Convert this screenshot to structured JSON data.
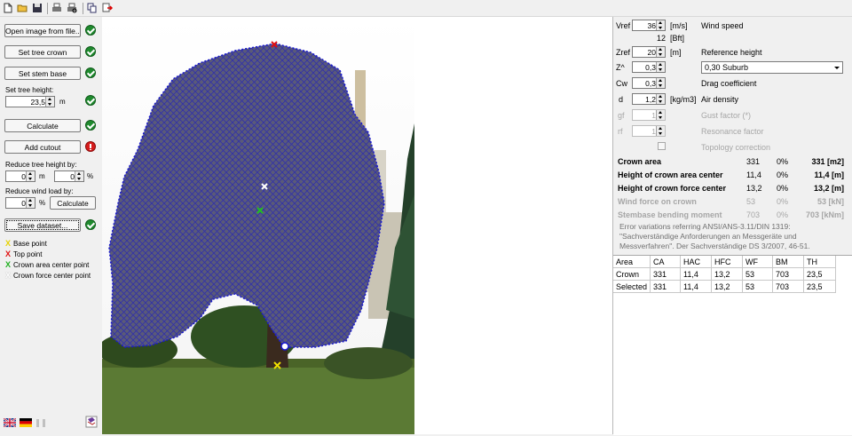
{
  "left": {
    "open_image": "Open image from file...",
    "set_crown": "Set tree crown",
    "set_stem": "Set stem base",
    "set_height_label": "Set tree height:",
    "tree_height": "23,5",
    "height_unit": "m",
    "calculate": "Calculate",
    "add_cutout": "Add cutout",
    "reduce_height_label": "Reduce tree height by:",
    "reduce_height_m": "0",
    "reduce_height_pct": "0",
    "unit_m": "m",
    "unit_pct": "%",
    "reduce_wind_label": "Reduce wind load by:",
    "reduce_wind_pct": "0",
    "calculate2": "Calculate",
    "save_dataset": "Save dataset...",
    "legend": [
      {
        "mark": "X",
        "color": "#e6d200",
        "label": "Base point"
      },
      {
        "mark": "X",
        "color": "#e01010",
        "label": "Top point"
      },
      {
        "mark": "X",
        "color": "#20b020",
        "label": "Crown area center point"
      },
      {
        "mark": "X",
        "color": "#ffffff",
        "label": "Crown force center point"
      }
    ]
  },
  "params": {
    "vref_label": "Vref",
    "vref": "36",
    "vref_unit": "[m/s]",
    "vref_desc": "Wind speed",
    "bft": "12",
    "bft_unit": "[Bft]",
    "zref_label": "Zref",
    "zref": "20",
    "zref_unit": "[m]",
    "zref_desc": "Reference height",
    "z_label": "Z^",
    "z": "0,3",
    "z_select": "0,30 Suburb",
    "cw_label": "Cw",
    "cw": "0,3",
    "cw_desc": "Drag coefficient",
    "d_label": "d",
    "d": "1,2",
    "d_unit": "[kg/m3]",
    "d_desc": "Air density",
    "gf_label": "gf",
    "gf": "1",
    "gf_desc": "Gust factor (*)",
    "rf_label": "rf",
    "rf": "1",
    "rf_desc": "Resonance factor",
    "topo_desc": "Topology correction"
  },
  "results": [
    {
      "label": "Crown area",
      "value": "331",
      "pct": "0%",
      "total": "331 [m2]",
      "disabled": false
    },
    {
      "label": "Height of crown area center",
      "value": "11,4",
      "pct": "0%",
      "total": "11,4 [m]",
      "disabled": false
    },
    {
      "label": "Height of crown force center",
      "value": "13,2",
      "pct": "0%",
      "total": "13,2 [m]",
      "disabled": false
    },
    {
      "label": "Wind force on crown",
      "value": "53",
      "pct": "0%",
      "total": "53 [kN]",
      "disabled": true
    },
    {
      "label": "Stembase bending moment",
      "value": "703",
      "pct": "0%",
      "total": "703 [kNm]",
      "disabled": true
    }
  ],
  "note": [
    "Error variations referring ANSI/ANS-3.11/DIN 1319:",
    "\"Sachverständige Anforderungen an Messgeräte und",
    "Messverfahren\". Der Sachverständige DS 3/2007, 46-51."
  ],
  "table": {
    "headers": [
      "Area",
      "CA",
      "HAC",
      "HFC",
      "WF",
      "BM",
      "TH"
    ],
    "rows": [
      [
        "Crown",
        "331",
        "11,4",
        "13,2",
        "53",
        "703",
        "23,5"
      ],
      [
        "Selected",
        "331",
        "11,4",
        "13,2",
        "53",
        "703",
        "23,5"
      ]
    ]
  },
  "colors": {
    "mesh": "#2a2ab0",
    "accent_ok": "#1f8a2e",
    "accent_err": "#d61c1c"
  }
}
